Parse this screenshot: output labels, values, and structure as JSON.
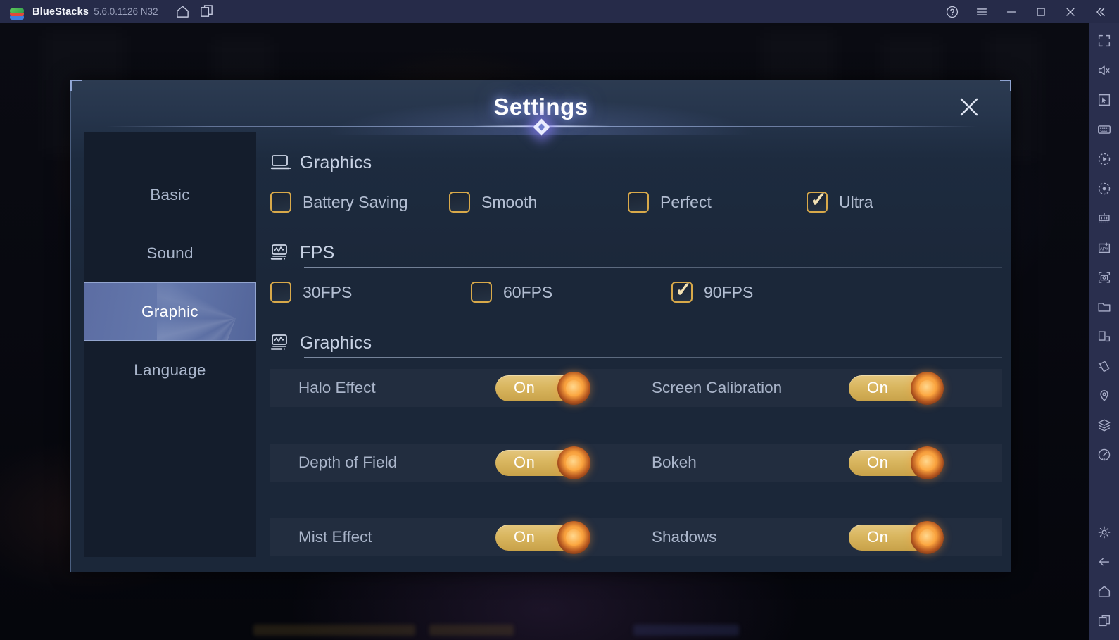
{
  "titlebar": {
    "app_name": "BlueStacks",
    "version": "5.6.0.1126 N32",
    "icons": {
      "home": "home-icon",
      "multi_instance": "multi-instance-icon",
      "help": "help-icon",
      "menu": "menu-icon",
      "minimize": "minimize-icon",
      "maximize": "maximize-icon",
      "close": "close-icon",
      "collapse": "collapse-icon"
    }
  },
  "sidebar_right": {
    "items": [
      {
        "name": "fullscreen-icon"
      },
      {
        "name": "mute-icon"
      },
      {
        "name": "cursor-icon"
      },
      {
        "name": "keyboard-icon"
      },
      {
        "name": "macro-record-icon"
      },
      {
        "name": "record-screen-icon"
      },
      {
        "name": "game-controls-icon"
      },
      {
        "name": "install-apk-icon"
      },
      {
        "name": "screenshot-icon"
      },
      {
        "name": "media-folder-icon"
      },
      {
        "name": "rotate-icon"
      },
      {
        "name": "shake-icon"
      },
      {
        "name": "location-icon"
      },
      {
        "name": "multi-instance-manager-icon"
      },
      {
        "name": "eco-mode-icon"
      }
    ],
    "bottom_items": [
      {
        "name": "settings-gear-icon"
      },
      {
        "name": "back-arrow-icon"
      },
      {
        "name": "android-home-icon"
      },
      {
        "name": "recent-apps-icon"
      }
    ]
  },
  "dialog": {
    "title": "Settings",
    "close_label": "close-dialog",
    "nav": {
      "items": [
        {
          "label": "Basic",
          "active": false
        },
        {
          "label": "Sound",
          "active": false
        },
        {
          "label": "Graphic",
          "active": true
        },
        {
          "label": "Language",
          "active": false
        }
      ]
    },
    "sections": [
      {
        "id": "graphics-quality",
        "icon": "monitor-icon",
        "title": "Graphics",
        "type": "checkboxes",
        "options": [
          {
            "label": "Battery Saving",
            "checked": false
          },
          {
            "label": "Smooth",
            "checked": false
          },
          {
            "label": "Perfect",
            "checked": false
          },
          {
            "label": "Ultra",
            "checked": true
          }
        ]
      },
      {
        "id": "fps",
        "icon": "chart-monitor-icon",
        "title": "FPS",
        "type": "checkboxes",
        "options": [
          {
            "label": "30FPS",
            "checked": false
          },
          {
            "label": "60FPS",
            "checked": false
          },
          {
            "label": "90FPS",
            "checked": true
          }
        ]
      },
      {
        "id": "graphics-effects",
        "icon": "chart-monitor-icon",
        "title": "Graphics",
        "type": "toggles",
        "rows": [
          {
            "left": {
              "label": "Halo Effect",
              "state": "On"
            },
            "right": {
              "label": "Screen Calibration",
              "state": "On"
            }
          },
          {
            "left": {
              "label": "Depth of Field",
              "state": "On"
            },
            "right": {
              "label": "Bokeh",
              "state": "On"
            }
          },
          {
            "left": {
              "label": "Mist Effect",
              "state": "On"
            },
            "right": {
              "label": "Shadows",
              "state": "On"
            }
          }
        ]
      }
    ]
  },
  "colors": {
    "accent_gold": "#d8a94a",
    "toggle_track": "#d9b65f",
    "toggle_knob": "#f79f3c",
    "nav_active": "#6478ac",
    "dialog_bg": "#1b2739",
    "titlebar_bg": "#262b49"
  }
}
